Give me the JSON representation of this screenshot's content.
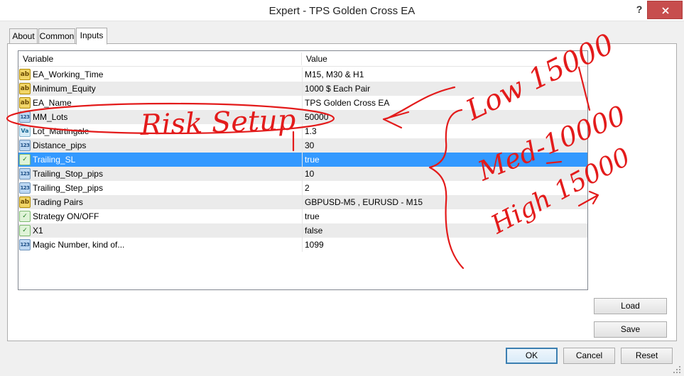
{
  "window": {
    "title": "Expert - TPS Golden Cross EA",
    "help_glyph": "?"
  },
  "tabs": [
    {
      "label": "About"
    },
    {
      "label": "Common"
    },
    {
      "label": "Inputs"
    }
  ],
  "grid": {
    "header": {
      "variable": "Variable",
      "value": "Value"
    },
    "rows": [
      {
        "name": "EA_Working_Time",
        "value": "M15, M30 & H1",
        "icon": "ab"
      },
      {
        "name": "Minimum_Equity",
        "value": "1000 $ Each Pair",
        "icon": "ab"
      },
      {
        "name": "EA_Name",
        "value": "TPS Golden Cross EA",
        "icon": "ab"
      },
      {
        "name": "MM_Lots",
        "value": "50000",
        "icon": "123"
      },
      {
        "name": "Lot_Martingale",
        "value": "1.3",
        "icon": "Va"
      },
      {
        "name": "Distance_pips",
        "value": "30",
        "icon": "123"
      },
      {
        "name": "Trailing_SL",
        "value": "true",
        "icon": "bool"
      },
      {
        "name": "Trailing_Stop_pips",
        "value": "10",
        "icon": "123"
      },
      {
        "name": "Trailing_Step_pips",
        "value": "2",
        "icon": "123"
      },
      {
        "name": "Trading Pairs",
        "value": "GBPUSD-M5 , EURUSD - M15",
        "icon": "ab"
      },
      {
        "name": "Strategy ON/OFF",
        "value": "true",
        "icon": "bool"
      },
      {
        "name": "X1",
        "value": "false",
        "icon": "bool"
      },
      {
        "name": "Magic Number, kind of...",
        "value": "1099",
        "icon": "123"
      }
    ],
    "selected_row": "Trailing_SL"
  },
  "side_buttons": {
    "load": "Load",
    "save": "Save"
  },
  "footer_buttons": {
    "ok": "OK",
    "cancel": "Cancel",
    "reset": "Reset"
  },
  "icon_labels": {
    "ab": "ab",
    "123": "123",
    "Va": "Va",
    "bool": "✓"
  },
  "annotations": {
    "risk_setup": "Risk Setup",
    "low": "Low 15000",
    "med": "Med-10000",
    "high": "High 15000"
  },
  "colors": {
    "selection": "#3399ff",
    "annotation_ink": "#e31b1b",
    "close_button": "#c74d4d"
  }
}
